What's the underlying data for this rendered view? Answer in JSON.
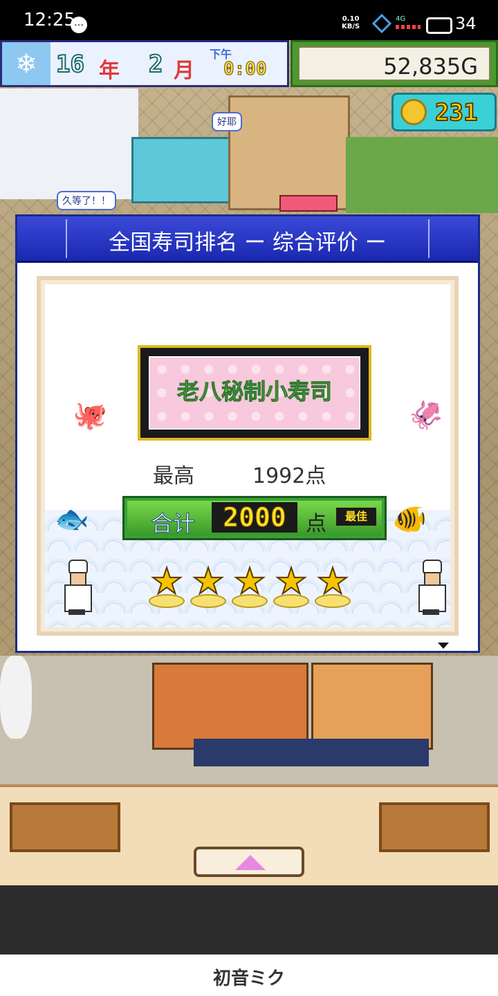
{
  "status_bar": {
    "time": "12:25",
    "speed": "0.10",
    "speed_unit": "KB/S",
    "network": "4G",
    "battery": "34"
  },
  "hud": {
    "year": "16",
    "year_suffix": "年",
    "month": "2",
    "month_suffix": "月",
    "period": "下午",
    "clock": "0:00",
    "money": "52,835G",
    "medals": "231"
  },
  "speech_bubbles": {
    "top": "好耶",
    "left": "久等了！！"
  },
  "dialog": {
    "title": "全国寿司排名 ー 综合评价 ー",
    "shop_name": "老八秘制小寿司",
    "best_label": "最高",
    "best_value": "1992点",
    "total_label": "合计",
    "total_value": "2000",
    "total_unit": "点",
    "total_badge": "最佳",
    "stars": 5
  },
  "nav": {
    "logo": "初音ミク"
  }
}
